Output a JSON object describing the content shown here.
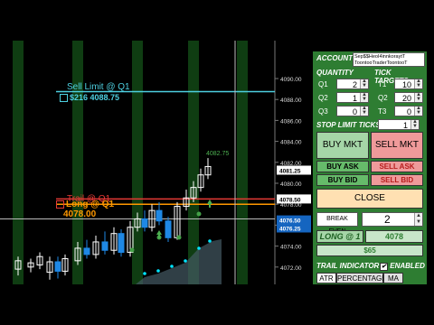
{
  "price_axis": {
    "ticks": [
      "4090.00",
      "4088.00",
      "4086.00",
      "4084.00",
      "4082.00",
      "4080.00",
      "4078.00",
      "4076.00",
      "4074.00",
      "4072.00"
    ],
    "tags": [
      {
        "label": "4081.25",
        "color": "#ffffff",
        "text_color": "#000000"
      },
      {
        "label": "4078.50",
        "color": "#ffffff",
        "text_color": "#000000"
      },
      {
        "label": "4076.50",
        "color": "#1565c0",
        "text_color": "#ffffff"
      },
      {
        "label": "4076.25",
        "color": "#1565c0",
        "text_color": "#ffffff"
      }
    ]
  },
  "chart": {
    "sell_limit_label": "Sell Limit @ Q1",
    "sell_limit_value": "$216 4088.75",
    "trail_label": "Trail @ Q1",
    "long_label": "Long @ Q1",
    "long_price": "4078.00",
    "high_label": "4082.75",
    "colors": {
      "sell_limit": "#4dd0e1",
      "trail": "#e53935",
      "long": "#ff9800",
      "up": "#ffffff",
      "down": "#1e88e5",
      "dots": "#00e5ff",
      "area": "#455a64"
    }
  },
  "panel": {
    "account_label": "ACCOUNT",
    "account_value": "Sep$$HeoI4innkoraytT ToontooTraderToontooT",
    "quantity_label": "QUANTITY",
    "tick_targets_label": "TICK TARGETS",
    "rows": [
      {
        "q": "Q1",
        "qv": "2",
        "t": "T1",
        "tv": "10"
      },
      {
        "q": "Q2",
        "qv": "1",
        "t": "Q2",
        "tv": "20"
      },
      {
        "q": "Q3",
        "qv": "0",
        "t": "T3",
        "tv": "0"
      }
    ],
    "stop_limit_label": "STOP LIMIT TICKS",
    "stop_limit_value": "1",
    "buy_mkt": "BUY MKT",
    "sell_mkt": "SELL MKT",
    "buy_ask": "BUY ASK",
    "sell_ask": "SELL ASK",
    "buy_bid": "BUY BID",
    "sell_bid": "SELL BID",
    "close": "CLOSE",
    "break_even_label": "BREAK EVEN",
    "break_even_value": "2",
    "position_label": "LONG @ 1",
    "position_price": "4078",
    "pnl": "$65",
    "trail_indicator_label": "TRAIL INDICATOR",
    "enabled_label": "ENABLED",
    "tabs": [
      "ATR",
      "PERCENTAGE",
      "MA"
    ]
  }
}
